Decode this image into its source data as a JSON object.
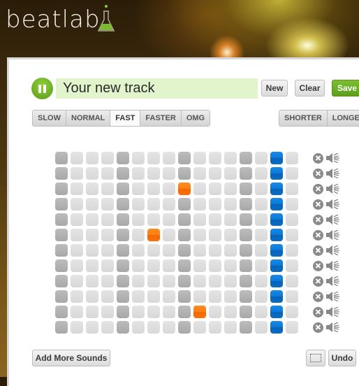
{
  "app": {
    "logo_text": "beatlab"
  },
  "toolbar": {
    "play_state": "playing",
    "track_name": "Your new track",
    "new_label": "New",
    "clear_label": "Clear",
    "save_label": "Save"
  },
  "tempo": {
    "options": [
      "SLOW",
      "NORMAL",
      "FAST",
      "FASTER",
      "OMG"
    ],
    "selected": "FAST"
  },
  "length": {
    "options": [
      "SHORTER",
      "LONGER"
    ]
  },
  "sequencer": {
    "rows": 12,
    "steps": 16,
    "beat_steps": [
      0,
      4,
      8,
      12
    ],
    "playhead_step": 14,
    "active_cells": [
      {
        "row": 2,
        "step": 8
      },
      {
        "row": 5,
        "step": 6
      },
      {
        "row": 10,
        "step": 9
      }
    ],
    "colors": {
      "active": "#ff7f14",
      "playhead": "#0a78d8",
      "accent": "#6aaa24"
    },
    "row_controls": [
      "remove-icon",
      "speaker-icon"
    ]
  },
  "footer": {
    "add_sounds_label": "Add More Sounds",
    "undo_label": "Undo"
  }
}
